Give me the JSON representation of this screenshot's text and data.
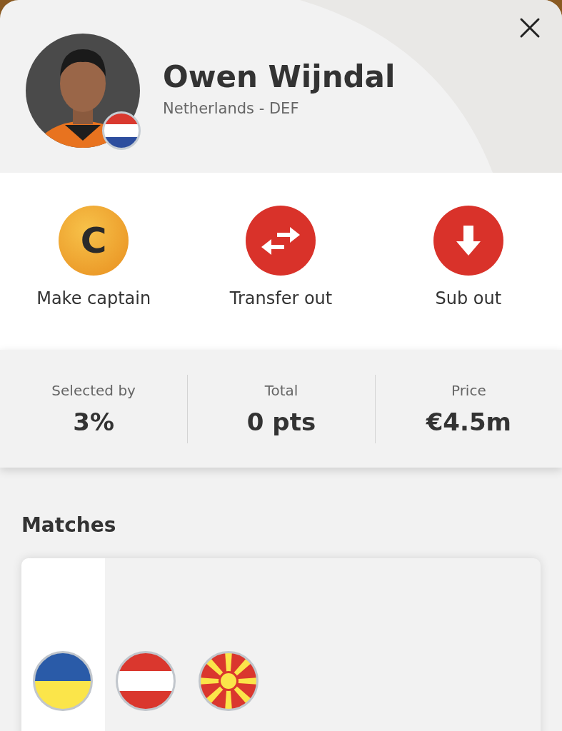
{
  "player": {
    "name": "Owen Wijndal",
    "subtitle": "Netherlands - DEF"
  },
  "actions": [
    {
      "kind": "captain",
      "icon_text": "C",
      "label": "Make captain"
    },
    {
      "kind": "transfer",
      "label": "Transfer out"
    },
    {
      "kind": "sub",
      "label": "Sub out"
    }
  ],
  "stats": [
    {
      "label": "Selected by",
      "value": "3%"
    },
    {
      "label": "Total",
      "value": "0 pts"
    },
    {
      "label": "Price",
      "value": "€4.5m"
    }
  ],
  "matches": {
    "title": "Matches",
    "flags": [
      {
        "kind": "two-stripe"
      },
      {
        "kind": "three-stripe"
      },
      {
        "kind": "sunburst"
      }
    ]
  }
}
